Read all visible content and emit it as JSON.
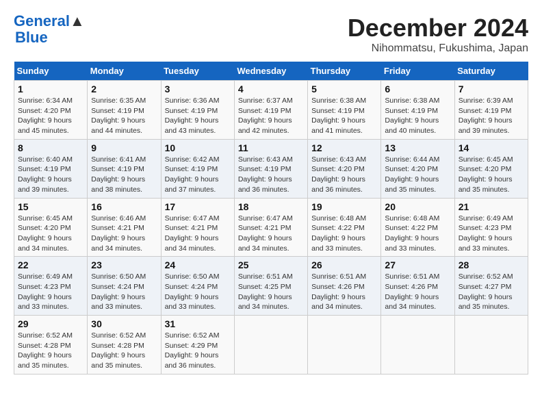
{
  "header": {
    "logo_line1": "General",
    "logo_line2": "Blue",
    "title": "December 2024",
    "subtitle": "Nihommatsu, Fukushima, Japan"
  },
  "calendar": {
    "days_of_week": [
      "Sunday",
      "Monday",
      "Tuesday",
      "Wednesday",
      "Thursday",
      "Friday",
      "Saturday"
    ],
    "weeks": [
      [
        {
          "day": "1",
          "sunrise": "Sunrise: 6:34 AM",
          "sunset": "Sunset: 4:20 PM",
          "daylight": "Daylight: 9 hours and 45 minutes."
        },
        {
          "day": "2",
          "sunrise": "Sunrise: 6:35 AM",
          "sunset": "Sunset: 4:19 PM",
          "daylight": "Daylight: 9 hours and 44 minutes."
        },
        {
          "day": "3",
          "sunrise": "Sunrise: 6:36 AM",
          "sunset": "Sunset: 4:19 PM",
          "daylight": "Daylight: 9 hours and 43 minutes."
        },
        {
          "day": "4",
          "sunrise": "Sunrise: 6:37 AM",
          "sunset": "Sunset: 4:19 PM",
          "daylight": "Daylight: 9 hours and 42 minutes."
        },
        {
          "day": "5",
          "sunrise": "Sunrise: 6:38 AM",
          "sunset": "Sunset: 4:19 PM",
          "daylight": "Daylight: 9 hours and 41 minutes."
        },
        {
          "day": "6",
          "sunrise": "Sunrise: 6:38 AM",
          "sunset": "Sunset: 4:19 PM",
          "daylight": "Daylight: 9 hours and 40 minutes."
        },
        {
          "day": "7",
          "sunrise": "Sunrise: 6:39 AM",
          "sunset": "Sunset: 4:19 PM",
          "daylight": "Daylight: 9 hours and 39 minutes."
        }
      ],
      [
        {
          "day": "8",
          "sunrise": "Sunrise: 6:40 AM",
          "sunset": "Sunset: 4:19 PM",
          "daylight": "Daylight: 9 hours and 39 minutes."
        },
        {
          "day": "9",
          "sunrise": "Sunrise: 6:41 AM",
          "sunset": "Sunset: 4:19 PM",
          "daylight": "Daylight: 9 hours and 38 minutes."
        },
        {
          "day": "10",
          "sunrise": "Sunrise: 6:42 AM",
          "sunset": "Sunset: 4:19 PM",
          "daylight": "Daylight: 9 hours and 37 minutes."
        },
        {
          "day": "11",
          "sunrise": "Sunrise: 6:43 AM",
          "sunset": "Sunset: 4:19 PM",
          "daylight": "Daylight: 9 hours and 36 minutes."
        },
        {
          "day": "12",
          "sunrise": "Sunrise: 6:43 AM",
          "sunset": "Sunset: 4:20 PM",
          "daylight": "Daylight: 9 hours and 36 minutes."
        },
        {
          "day": "13",
          "sunrise": "Sunrise: 6:44 AM",
          "sunset": "Sunset: 4:20 PM",
          "daylight": "Daylight: 9 hours and 35 minutes."
        },
        {
          "day": "14",
          "sunrise": "Sunrise: 6:45 AM",
          "sunset": "Sunset: 4:20 PM",
          "daylight": "Daylight: 9 hours and 35 minutes."
        }
      ],
      [
        {
          "day": "15",
          "sunrise": "Sunrise: 6:45 AM",
          "sunset": "Sunset: 4:20 PM",
          "daylight": "Daylight: 9 hours and 34 minutes."
        },
        {
          "day": "16",
          "sunrise": "Sunrise: 6:46 AM",
          "sunset": "Sunset: 4:21 PM",
          "daylight": "Daylight: 9 hours and 34 minutes."
        },
        {
          "day": "17",
          "sunrise": "Sunrise: 6:47 AM",
          "sunset": "Sunset: 4:21 PM",
          "daylight": "Daylight: 9 hours and 34 minutes."
        },
        {
          "day": "18",
          "sunrise": "Sunrise: 6:47 AM",
          "sunset": "Sunset: 4:21 PM",
          "daylight": "Daylight: 9 hours and 34 minutes."
        },
        {
          "day": "19",
          "sunrise": "Sunrise: 6:48 AM",
          "sunset": "Sunset: 4:22 PM",
          "daylight": "Daylight: 9 hours and 33 minutes."
        },
        {
          "day": "20",
          "sunrise": "Sunrise: 6:48 AM",
          "sunset": "Sunset: 4:22 PM",
          "daylight": "Daylight: 9 hours and 33 minutes."
        },
        {
          "day": "21",
          "sunrise": "Sunrise: 6:49 AM",
          "sunset": "Sunset: 4:23 PM",
          "daylight": "Daylight: 9 hours and 33 minutes."
        }
      ],
      [
        {
          "day": "22",
          "sunrise": "Sunrise: 6:49 AM",
          "sunset": "Sunset: 4:23 PM",
          "daylight": "Daylight: 9 hours and 33 minutes."
        },
        {
          "day": "23",
          "sunrise": "Sunrise: 6:50 AM",
          "sunset": "Sunset: 4:24 PM",
          "daylight": "Daylight: 9 hours and 33 minutes."
        },
        {
          "day": "24",
          "sunrise": "Sunrise: 6:50 AM",
          "sunset": "Sunset: 4:24 PM",
          "daylight": "Daylight: 9 hours and 33 minutes."
        },
        {
          "day": "25",
          "sunrise": "Sunrise: 6:51 AM",
          "sunset": "Sunset: 4:25 PM",
          "daylight": "Daylight: 9 hours and 34 minutes."
        },
        {
          "day": "26",
          "sunrise": "Sunrise: 6:51 AM",
          "sunset": "Sunset: 4:26 PM",
          "daylight": "Daylight: 9 hours and 34 minutes."
        },
        {
          "day": "27",
          "sunrise": "Sunrise: 6:51 AM",
          "sunset": "Sunset: 4:26 PM",
          "daylight": "Daylight: 9 hours and 34 minutes."
        },
        {
          "day": "28",
          "sunrise": "Sunrise: 6:52 AM",
          "sunset": "Sunset: 4:27 PM",
          "daylight": "Daylight: 9 hours and 35 minutes."
        }
      ],
      [
        {
          "day": "29",
          "sunrise": "Sunrise: 6:52 AM",
          "sunset": "Sunset: 4:28 PM",
          "daylight": "Daylight: 9 hours and 35 minutes."
        },
        {
          "day": "30",
          "sunrise": "Sunrise: 6:52 AM",
          "sunset": "Sunset: 4:28 PM",
          "daylight": "Daylight: 9 hours and 35 minutes."
        },
        {
          "day": "31",
          "sunrise": "Sunrise: 6:52 AM",
          "sunset": "Sunset: 4:29 PM",
          "daylight": "Daylight: 9 hours and 36 minutes."
        },
        null,
        null,
        null,
        null
      ]
    ]
  }
}
